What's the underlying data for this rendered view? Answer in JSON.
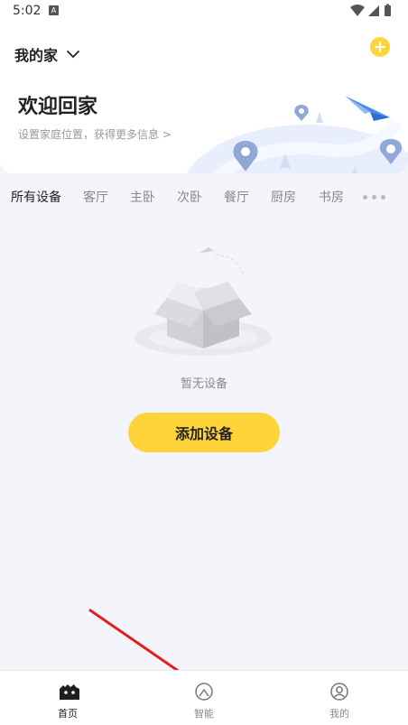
{
  "status_bar": {
    "time": "5:02",
    "notification_badge": "A"
  },
  "header": {
    "home_name": "我的家",
    "welcome_title": "欢迎回家",
    "welcome_subtitle": "设置家庭位置，获得更多信息 >"
  },
  "tabs": [
    {
      "label": "所有设备",
      "active": true
    },
    {
      "label": "客厅",
      "active": false
    },
    {
      "label": "主卧",
      "active": false
    },
    {
      "label": "次卧",
      "active": false
    },
    {
      "label": "餐厅",
      "active": false
    },
    {
      "label": "厨房",
      "active": false
    },
    {
      "label": "书房",
      "active": false
    }
  ],
  "empty_state": {
    "text": "暂无设备",
    "button_label": "添加设备"
  },
  "bottom_nav": [
    {
      "label": "首页",
      "icon": "home-icon",
      "active": true
    },
    {
      "label": "智能",
      "icon": "smart-icon",
      "active": false
    },
    {
      "label": "我的",
      "icon": "profile-icon",
      "active": false
    }
  ],
  "colors": {
    "accent": "#ffd43b",
    "background": "#f3f5fa",
    "annotation_arrow": "#e02020"
  }
}
